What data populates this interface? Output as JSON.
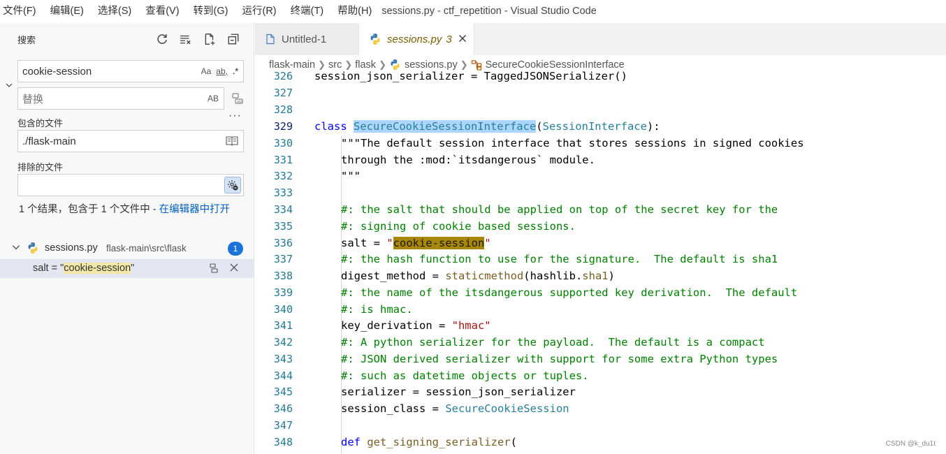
{
  "menu": [
    "文件(F)",
    "编辑(E)",
    "选择(S)",
    "查看(V)",
    "转到(G)",
    "运行(R)",
    "终端(T)",
    "帮助(H)"
  ],
  "window_title": "sessions.py - ctf_repetition - Visual Studio Code",
  "sidebar": {
    "title": "搜索",
    "actions": [
      "refresh-icon",
      "clear-results-icon",
      "new-search-editor-icon",
      "collapse-all-icon"
    ],
    "search": {
      "value": "cookie-session",
      "opt_case": "Aa",
      "opt_word": "ab",
      "opt_regex": ".*"
    },
    "replace": {
      "placeholder": "替换",
      "opt_preserve_case": "AB"
    },
    "more": "···",
    "include": {
      "label": "包含的文件",
      "value": "./flask-main"
    },
    "exclude": {
      "label": "排除的文件",
      "value": ""
    },
    "summary": {
      "text": "1 个结果，包含于 1 个文件中 - ",
      "link": "在编辑器中打开"
    },
    "results": {
      "file_name": "sessions.py",
      "file_path": "flask-main\\src\\flask",
      "count": "1",
      "match_prefix": "salt = \"",
      "match_hl": "cookie-session",
      "match_suffix": "\""
    }
  },
  "tabs": [
    {
      "label": "Untitled-1"
    },
    {
      "label": "sessions.py",
      "problems": "3"
    }
  ],
  "breadcrumb": [
    "flask-main",
    "src",
    "flask",
    "sessions.py",
    "SecureCookieSessionInterface"
  ],
  "code": {
    "line_numbers": [
      "326",
      "327",
      "328",
      "329",
      "330",
      "331",
      "332",
      "333",
      "334",
      "335",
      "336",
      "337",
      "338",
      "339",
      "340",
      "341",
      "342",
      "343",
      "344",
      "345",
      "346",
      "347",
      "348"
    ],
    "l326": "session_json_serializer = TaggedJSONSerializer()",
    "l329_kw": "class ",
    "l329_name": "SecureCookieSessionInterface",
    "l329_open": "(",
    "l329_base": "SessionInterface",
    "l329_close": "):",
    "l330": "\"\"\"The default session interface that stores sessions in signed cookies",
    "l331": "through the :mod:`itsdangerous` module.",
    "l332": "\"\"\"",
    "l334": "#: the salt that should be applied on top of the secret key for the",
    "l335": "#: signing of cookie based sessions.",
    "l336_pre": "salt = ",
    "l336_q1": "\"",
    "l336_hl": "cookie-session",
    "l336_q2": "\"",
    "l337": "#: the hash function to use for the signature.  The default is sha1",
    "l338_pre": "digest_method = ",
    "l338_fn": "staticmethod",
    "l338_mid": "(hashlib.",
    "l338_attr": "sha1",
    "l338_end": ")",
    "l339": "#: the name of the itsdangerous supported key derivation.  The default",
    "l340": "#: is hmac.",
    "l341_pre": "key_derivation = ",
    "l341_str": "\"hmac\"",
    "l342": "#: A python serializer for the payload.  The default is a compact",
    "l343": "#: JSON derived serializer with support for some extra Python types",
    "l344": "#: such as datetime objects or tuples.",
    "l345": "serializer = session_json_serializer",
    "l346_pre": "session_class = ",
    "l346_cls": "SecureCookieSession",
    "l348_kw": "def ",
    "l348_fn": "get_signing_serializer",
    "l348_rest": "("
  },
  "watermark": "CSDN @k_du1t",
  "colors": {
    "accent": "#1a73d6",
    "find_highlight": "#a8870a",
    "selection": "#add6ff"
  }
}
